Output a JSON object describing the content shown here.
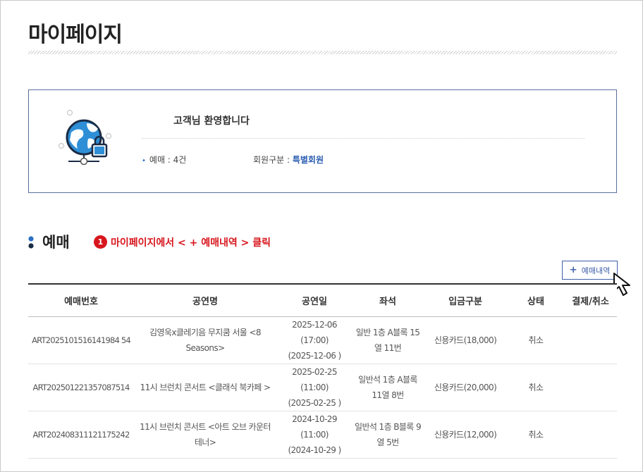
{
  "page": {
    "title": "마이페이지"
  },
  "welcome": {
    "message": "고객님 환영합니다",
    "booking_label": "예매 : ",
    "booking_count": "4건",
    "member_label": "회원구분 : ",
    "member_type": "특별회원"
  },
  "section": {
    "title": "예매",
    "step_number": "1",
    "step_text": "마이페이지에서 < + 예매내역 > 클릭"
  },
  "toolbar": {
    "history_button_icon": "+",
    "history_button_label": "예매내역"
  },
  "table": {
    "headers": [
      "예매번호",
      "공연명",
      "공연일",
      "좌석",
      "입금구분",
      "상태",
      "결제/취소"
    ],
    "rows": [
      {
        "id": "ART2025101516141984 54",
        "show": "김영욱x클레기음 무지쿰 서울 <8 Seasons>",
        "date1": "2025-12-06 (17:00)",
        "date2": "(2025-12-06 )",
        "seat": "일반 1층 A블록 15열 11번",
        "payment": "신용카드(18,000)",
        "status": "취소",
        "action": ""
      },
      {
        "id": "ART202501221357087514",
        "show": "11시 브런치 콘서트 <클래식 북카페 >",
        "date1": "2025-02-25 (11:00)",
        "date2": "(2025-02-25 )",
        "seat": "일반석 1층 A블록 11열 8번",
        "payment": "신용카드(20,000)",
        "status": "취소",
        "action": ""
      },
      {
        "id": "ART202408311121175242",
        "show": "11시 브런치 콘서트 <아트 오브 카운터테너>",
        "date1": "2024-10-29 (11:00)",
        "date2": "(2024-10-29 )",
        "seat": "일반석 1층 B블록 9열 5번",
        "payment": "신용카드(12,000)",
        "status": "취소",
        "action": ""
      }
    ]
  }
}
